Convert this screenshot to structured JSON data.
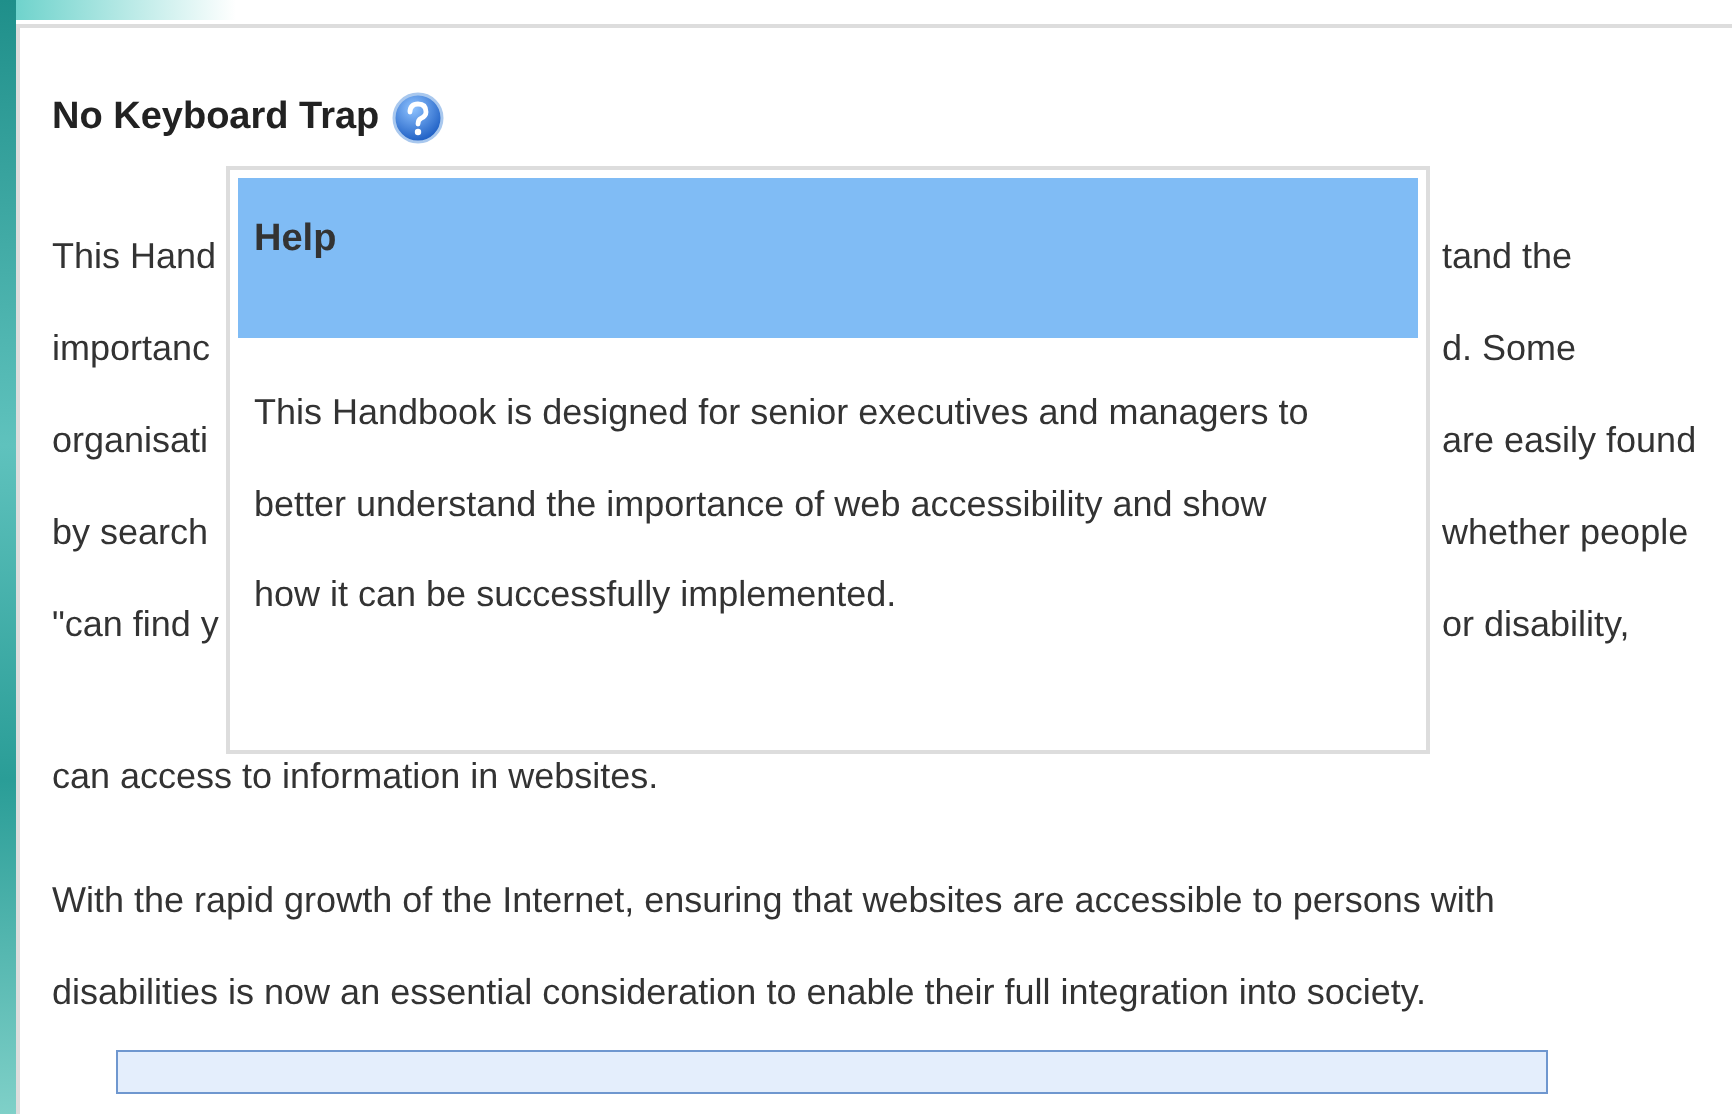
{
  "heading": "No Keyboard Trap",
  "paragraph_lines": [
    {
      "left": "This Hand",
      "right": "tand the"
    },
    {
      "left": "importanc",
      "right": "d. Some"
    },
    {
      "left": "organisati",
      "right": "are easily found"
    },
    {
      "left": "by search",
      "right": "whether people"
    },
    {
      "left": "\"can find y",
      "right": "or disability,"
    }
  ],
  "paragraph_end": "can access to information in websites.",
  "paragraph_2": "With the rapid growth of the Internet, ensuring that websites are accessible to persons with disabilities is now an essential consideration to enable their full integration into society.",
  "help_popup": {
    "title": "Help",
    "body": "This Handbook is designed for senior executives and managers to better understand the importance of web accessibility and show how it can be successfully implemented."
  }
}
